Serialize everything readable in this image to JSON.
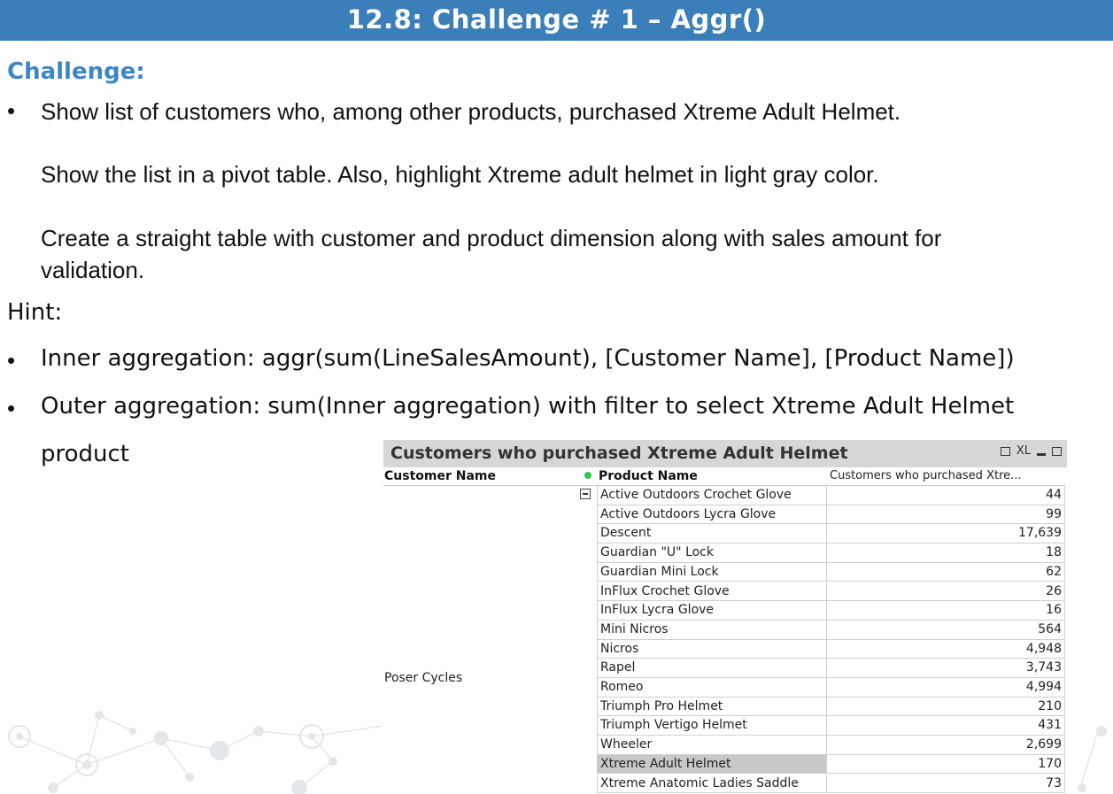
{
  "slide": {
    "title": "12.8: Challenge # 1 – Aggr()",
    "challenge_heading": "Challenge:",
    "bullet_glyph": "•",
    "challenge_lines": [
      "Show list of customers who,  among other products, purchased Xtreme Adult Helmet.",
      "Show the list in a pivot table. Also, highlight Xtreme adult helmet in light gray color.",
      "Create a straight table with customer and product dimension along with sales amount for",
      "validation."
    ],
    "hint_heading": "Hint:",
    "hint_lines": [
      "Inner aggregation:  aggr(sum(LineSalesAmount), [Customer Name], [Product Name])",
      "Outer aggregation:  sum(Inner aggregation)  with filter to select Xtreme Adult Helmet",
      "product"
    ]
  },
  "pivot_table": {
    "title": "Customers who purchased Xtreme Adult Helmet",
    "header_icons": [
      "print-icon",
      "excel-xl-icon",
      "minimize-icon",
      "maximize-icon"
    ],
    "xl_label": "XL",
    "columns": {
      "customer": "Customer Name",
      "product": "Product Name",
      "value": "Customers who purchased Xtre..."
    },
    "customer": "Poser Cycles",
    "highlight_color": "#c8c8c8",
    "rows": [
      {
        "product": "Active Outdoors Crochet Glove",
        "value": "44"
      },
      {
        "product": "Active Outdoors Lycra Glove",
        "value": "99"
      },
      {
        "product": "Descent",
        "value": "17,639"
      },
      {
        "product": "Guardian \"U\" Lock",
        "value": "18"
      },
      {
        "product": "Guardian Mini Lock",
        "value": "62"
      },
      {
        "product": "InFlux Crochet Glove",
        "value": "26"
      },
      {
        "product": "InFlux Lycra Glove",
        "value": "16"
      },
      {
        "product": "Mini Nicros",
        "value": "564"
      },
      {
        "product": "Nicros",
        "value": "4,948"
      },
      {
        "product": "Rapel",
        "value": "3,743"
      },
      {
        "product": "Romeo",
        "value": "4,994"
      },
      {
        "product": "Triumph Pro Helmet",
        "value": "210"
      },
      {
        "product": "Triumph Vertigo Helmet",
        "value": "431"
      },
      {
        "product": "Wheeler",
        "value": "2,699"
      },
      {
        "product": "Xtreme Adult Helmet",
        "value": "170",
        "highlighted": true
      },
      {
        "product": "Xtreme Anatomic Ladies Saddle",
        "value": "73"
      }
    ]
  }
}
